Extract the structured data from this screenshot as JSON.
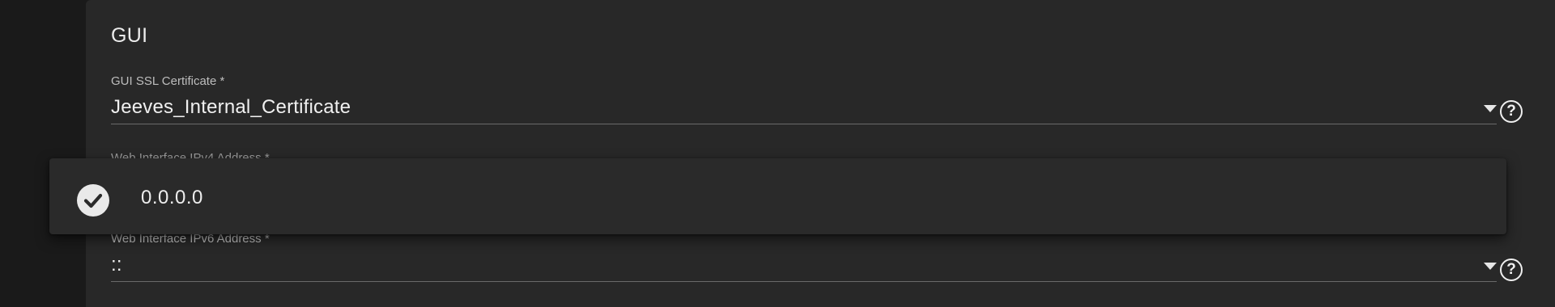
{
  "section": {
    "title": "GUI"
  },
  "ssl_certificate": {
    "label": "GUI SSL Certificate *",
    "value": "Jeeves_Internal_Certificate",
    "help_symbol": "?"
  },
  "ipv4": {
    "label": "Web Interface IPv4 Address *",
    "options": [
      {
        "label": "0.0.0.0",
        "selected": true
      }
    ]
  },
  "ipv6": {
    "label": "Web Interface IPv6 Address *",
    "value": "::",
    "help_symbol": "?"
  },
  "icons": {
    "dropdown": "chevron-down-icon",
    "help": "help-circle-icon",
    "selected": "check-circle-icon"
  },
  "colors": {
    "background": "#1a1a1a",
    "card": "#282828",
    "text": "#e6e6e6"
  }
}
